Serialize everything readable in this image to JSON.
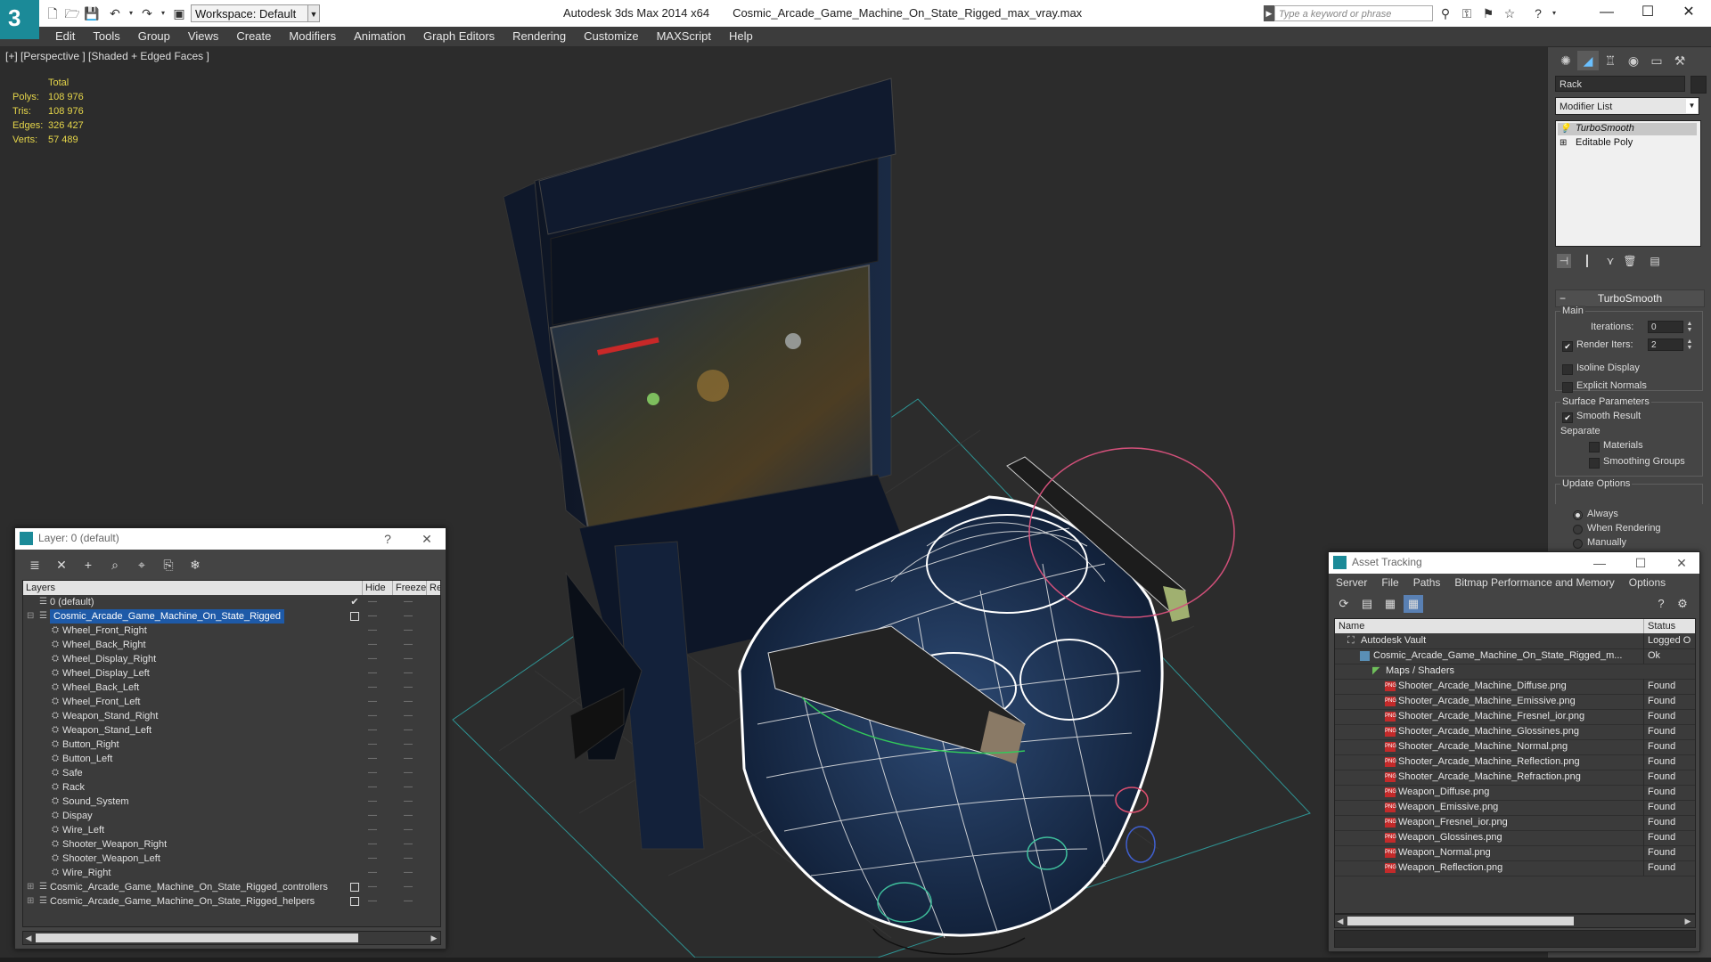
{
  "titlebar": {
    "workspace_label": "Workspace: Default",
    "app_name": "Autodesk 3ds Max  2014 x64",
    "file_name": "Cosmic_Arcade_Game_Machine_On_State_Rigged_max_vray.max",
    "search_placeholder": "Type a keyword or phrase"
  },
  "menu": [
    "Edit",
    "Tools",
    "Group",
    "Views",
    "Create",
    "Modifiers",
    "Animation",
    "Graph Editors",
    "Rendering",
    "Customize",
    "MAXScript",
    "Help"
  ],
  "viewport": {
    "label": "[+] [Perspective ] [Shaded + Edged Faces ]",
    "stats": {
      "header": "Total",
      "polys_label": "Polys:",
      "polys": "108 976",
      "tris_label": "Tris:",
      "tris": "108 976",
      "edges_label": "Edges:",
      "edges": "326 427",
      "verts_label": "Verts:",
      "verts": "57 489"
    }
  },
  "command_panel": {
    "object_name": "Rack",
    "modifier_list": "Modifier List",
    "stack": [
      "TurboSmooth",
      "Editable Poly"
    ],
    "rollout_title": "TurboSmooth",
    "main_group": "Main",
    "iterations_label": "Iterations:",
    "iterations": "0",
    "render_iters_label": "Render Iters:",
    "render_iters": "2",
    "isoline_label": "Isoline Display",
    "explicit_label": "Explicit Normals",
    "surface_group": "Surface Parameters",
    "smooth_label": "Smooth Result",
    "separate_label": "Separate",
    "materials_label": "Materials",
    "smoothing_groups_label": "Smoothing Groups",
    "update_group": "Update Options",
    "always_label": "Always",
    "when_rendering_label": "When Rendering",
    "manually_label": "Manually"
  },
  "layer_window": {
    "title": "Layer: 0 (default)",
    "help": "?",
    "columns": {
      "layers": "Layers",
      "hide": "Hide",
      "freeze": "Freeze",
      "render": "Re"
    },
    "rows": [
      {
        "name": "0 (default)"
      },
      {
        "name": "Cosmic_Arcade_Game_Machine_On_State_Rigged"
      },
      {
        "name": "Wheel_Front_Right"
      },
      {
        "name": "Wheel_Back_Right"
      },
      {
        "name": "Wheel_Display_Right"
      },
      {
        "name": "Wheel_Display_Left"
      },
      {
        "name": "Wheel_Back_Left"
      },
      {
        "name": "Wheel_Front_Left"
      },
      {
        "name": "Weapon_Stand_Right"
      },
      {
        "name": "Weapon_Stand_Left"
      },
      {
        "name": "Button_Right"
      },
      {
        "name": "Button_Left"
      },
      {
        "name": "Safe"
      },
      {
        "name": "Rack"
      },
      {
        "name": "Sound_System"
      },
      {
        "name": "Dispay"
      },
      {
        "name": "Wire_Left"
      },
      {
        "name": "Shooter_Weapon_Right"
      },
      {
        "name": "Shooter_Weapon_Left"
      },
      {
        "name": "Wire_Right"
      },
      {
        "name": "Cosmic_Arcade_Game_Machine_On_State_Rigged_controllers"
      },
      {
        "name": "Cosmic_Arcade_Game_Machine_On_State_Rigged_helpers"
      }
    ]
  },
  "asset_window": {
    "title": "Asset Tracking",
    "menu": [
      "Server",
      "File",
      "Paths",
      "Bitmap Performance and Memory",
      "Options"
    ],
    "columns": {
      "name": "Name",
      "status": "Status"
    },
    "rows": [
      {
        "name": "Autodesk Vault",
        "status": "Logged O",
        "kind": "vault"
      },
      {
        "name": "Cosmic_Arcade_Game_Machine_On_State_Rigged_m...",
        "status": "Ok",
        "kind": "max"
      },
      {
        "name": "Maps / Shaders",
        "status": "",
        "kind": "folder"
      },
      {
        "name": "Shooter_Arcade_Machine_Diffuse.png",
        "status": "Found",
        "kind": "png"
      },
      {
        "name": "Shooter_Arcade_Machine_Emissive.png",
        "status": "Found",
        "kind": "png"
      },
      {
        "name": "Shooter_Arcade_Machine_Fresnel_ior.png",
        "status": "Found",
        "kind": "png"
      },
      {
        "name": "Shooter_Arcade_Machine_Glossines.png",
        "status": "Found",
        "kind": "png"
      },
      {
        "name": "Shooter_Arcade_Machine_Normal.png",
        "status": "Found",
        "kind": "png"
      },
      {
        "name": "Shooter_Arcade_Machine_Reflection.png",
        "status": "Found",
        "kind": "png"
      },
      {
        "name": "Shooter_Arcade_Machine_Refraction.png",
        "status": "Found",
        "kind": "png"
      },
      {
        "name": "Weapon_Diffuse.png",
        "status": "Found",
        "kind": "png"
      },
      {
        "name": "Weapon_Emissive.png",
        "status": "Found",
        "kind": "png"
      },
      {
        "name": "Weapon_Fresnel_ior.png",
        "status": "Found",
        "kind": "png"
      },
      {
        "name": "Weapon_Glossines.png",
        "status": "Found",
        "kind": "png"
      },
      {
        "name": "Weapon_Normal.png",
        "status": "Found",
        "kind": "png"
      },
      {
        "name": "Weapon_Reflection.png",
        "status": "Found",
        "kind": "png"
      }
    ]
  },
  "colors": {
    "accent": "#1b8a98",
    "selection": "#1e5aa8",
    "stats_text": "#e6d64a",
    "grid": "#3fb8b8",
    "wireframe": "#ffffff"
  }
}
